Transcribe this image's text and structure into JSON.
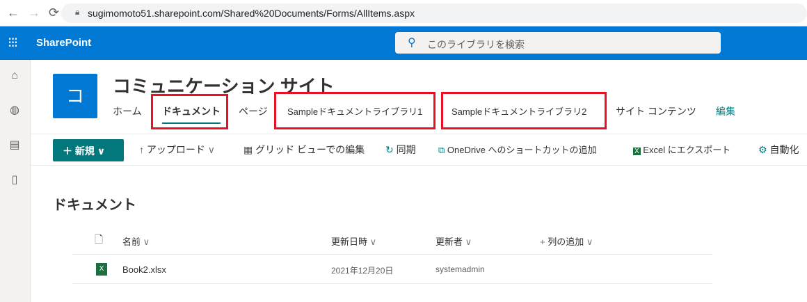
{
  "browser": {
    "back": "←",
    "forward": "→",
    "reload": "⟳",
    "url": "sugimomoto51.sharepoint.com/Shared%20Documents/Forms/AllItems.aspx"
  },
  "suite": {
    "app_name": "SharePoint",
    "search_placeholder": "このライブラリを検索"
  },
  "site": {
    "logo_letter": "コ",
    "title": "コミュニケーション サイト",
    "nav": [
      "ホーム",
      "ドキュメント",
      "ページ",
      "Sampleドキュメントライブラリ1",
      "Sampleドキュメントライブラリ2",
      "サイト コンテンツ",
      "編集"
    ]
  },
  "commands": {
    "new": "新規",
    "upload": "アップロード",
    "grid_edit": "グリッド ビューでの編集",
    "sync": "同期",
    "onedrive": "OneDrive へのショートカットの追加",
    "excel": "Excel にエクスポート",
    "automate": "自動化"
  },
  "library": {
    "title": "ドキュメント",
    "columns": {
      "name": "名前",
      "modified": "更新日時",
      "modified_by": "更新者",
      "add_column": "列の追加"
    },
    "rows": [
      {
        "name": "Book2.xlsx",
        "modified": "2021年12月20日",
        "modified_by": "systemadmin"
      }
    ]
  },
  "colors": {
    "brand": "#0078d4",
    "new_button": "#03787c",
    "highlight": "#e81123"
  }
}
